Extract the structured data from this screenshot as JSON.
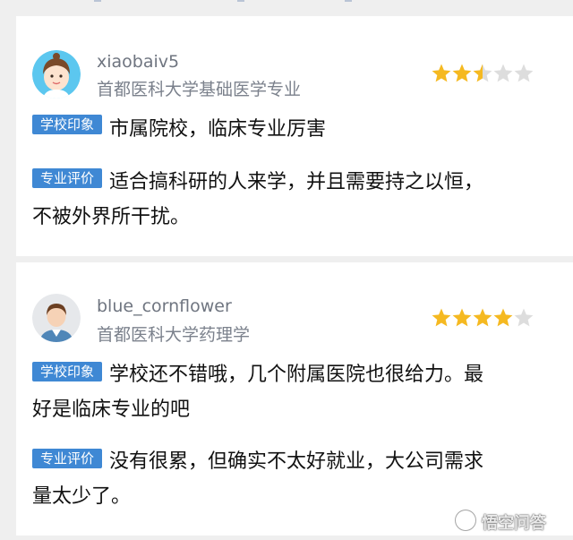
{
  "reviews": [
    {
      "username": "xiaobaiv5",
      "subtitle": "首都医科大学基础医学专业",
      "rating": 2.5,
      "rating_max": 5,
      "school_tag": "学校印象",
      "school_text_line1": "市属院校，临床专业厉害",
      "major_tag": "专业评价",
      "major_text_line1": "适合搞科研的人来学，并且需要持之以恒，",
      "major_text_line2": "不被外界所干扰。"
    },
    {
      "username": "blue_cornflower",
      "subtitle": "首都医科大学药理学",
      "rating": 4,
      "rating_max": 5,
      "school_tag": "学校印象",
      "school_text_line1": "学校还不错哦，几个附属医院也很给力。最",
      "school_text_line2": "好是临床专业的吧",
      "major_tag": "专业评价",
      "major_text_line1": "没有很累，但确实不太好就业，大公司需求",
      "major_text_line2": "量太少了。"
    }
  ],
  "watermark": {
    "text": "悟空问答"
  },
  "colors": {
    "tag_bg": "#3f88d4",
    "star_filled": "#f5b921",
    "star_empty": "#dddddd"
  }
}
